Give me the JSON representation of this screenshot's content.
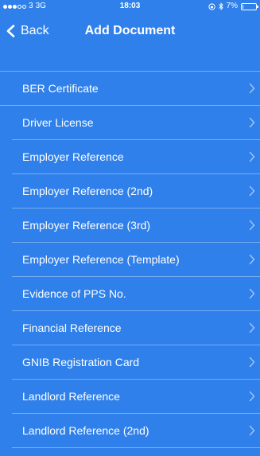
{
  "status_bar": {
    "carrier": "3",
    "network": "3G",
    "time": "18:03",
    "battery": "7%",
    "battery_level": 0.07
  },
  "nav": {
    "back_label": "Back",
    "title": "Add Document"
  },
  "documents": [
    {
      "label": "BER Certificate"
    },
    {
      "label": "Driver License"
    },
    {
      "label": "Employer Reference"
    },
    {
      "label": "Employer Reference (2nd)"
    },
    {
      "label": "Employer Reference (3rd)"
    },
    {
      "label": "Employer Reference (Template)"
    },
    {
      "label": "Evidence of PPS No."
    },
    {
      "label": "Financial Reference"
    },
    {
      "label": "GNIB Registration Card"
    },
    {
      "label": "Landlord Reference"
    },
    {
      "label": "Landlord Reference (2nd)"
    }
  ],
  "colors": {
    "background": "#2f80ea",
    "text": "#ffffff",
    "separator": "rgba(255,255,255,0.35)"
  },
  "icons": {
    "back": "chevron-left-icon",
    "disclosure": "chevron-right-icon",
    "bluetooth": "bluetooth-icon",
    "lock": "rotation-lock-icon",
    "battery": "battery-icon"
  }
}
